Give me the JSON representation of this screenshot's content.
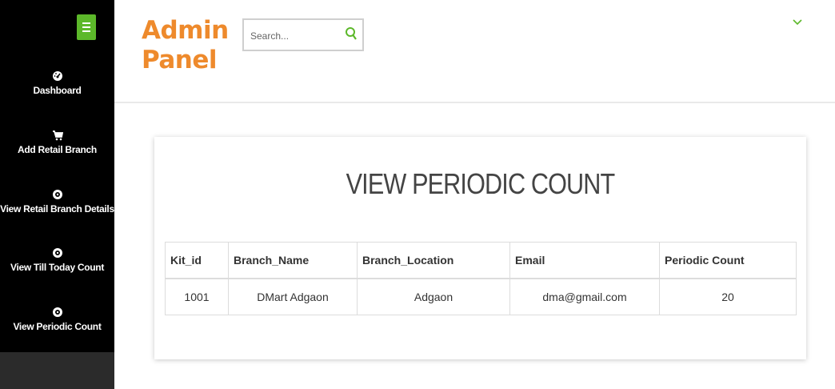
{
  "header": {
    "logo_line1": "Admin",
    "logo_line2": "Panel",
    "search_placeholder": "Search..."
  },
  "sidebar": {
    "items": [
      {
        "label": "Dashboard",
        "icon": "dashboard-icon"
      },
      {
        "label": "Add Retail Branch",
        "icon": "cart-icon"
      },
      {
        "label": "View Retail Branch Details",
        "icon": "eye-icon"
      },
      {
        "label": "View Till Today Count",
        "icon": "eye-icon"
      },
      {
        "label": "View Periodic Count",
        "icon": "eye-icon"
      }
    ]
  },
  "main": {
    "title": "VIEW PERIODIC COUNT",
    "table": {
      "headers": [
        "Kit_id",
        "Branch_Name",
        "Branch_Location",
        "Email",
        "Periodic Count"
      ],
      "rows": [
        [
          "1001",
          "DMart Adgaon",
          "Adgaon",
          "dma@gmail.com",
          "20"
        ]
      ]
    }
  },
  "colors": {
    "accent_orange": "#ee8a2c",
    "accent_green": "#5cb82a",
    "sidebar_bg": "#000000"
  }
}
